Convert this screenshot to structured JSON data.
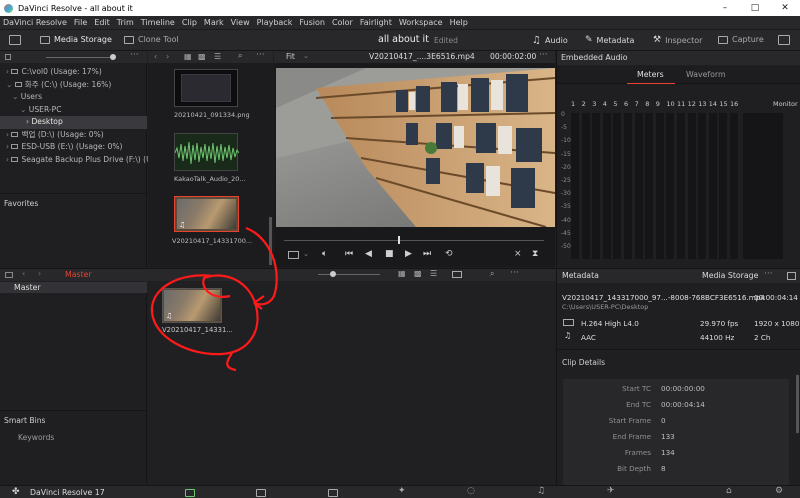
{
  "window": {
    "title": "DaVinci Resolve - all about it",
    "minimize": "–",
    "maximize": "□",
    "close": "✕"
  },
  "menu": [
    "DaVinci Resolve",
    "File",
    "Edit",
    "Trim",
    "Timeline",
    "Clip",
    "Mark",
    "View",
    "Playback",
    "Fusion",
    "Color",
    "Fairlight",
    "Workspace",
    "Help"
  ],
  "toolbar": {
    "media_storage": "Media Storage",
    "clone_tool": "Clone Tool",
    "project_name": "all about it",
    "project_status": "Edited",
    "audio": "Audio",
    "metadata": "Metadata",
    "inspector": "Inspector",
    "capture": "Capture"
  },
  "storage_tree": [
    {
      "label": "C:\\vol0 (Usage: 17%)",
      "indent": 0,
      "arrow": "›"
    },
    {
      "label": "화주 (C:\\) (Usage: 16%)",
      "indent": 0,
      "arrow": "⌄"
    },
    {
      "label": "Users",
      "indent": 1,
      "arrow": "⌄"
    },
    {
      "label": "USER-PC",
      "indent": 2,
      "arrow": "⌄"
    },
    {
      "label": "Desktop",
      "indent": 3,
      "arrow": "›"
    },
    {
      "label": "백업 (D:\\) (Usage: 0%)",
      "indent": 0,
      "arrow": "›"
    },
    {
      "label": "ESD-USB (E:\\) (Usage: 0%)",
      "indent": 0,
      "arrow": "›"
    },
    {
      "label": "Seagate Backup Plus Drive (F:\\) (Usage...",
      "indent": 0,
      "arrow": "›"
    }
  ],
  "favorites": "Favorites",
  "media_files": [
    {
      "label": "20210421_091334.png"
    },
    {
      "label": "KakaoTalk_Audio_20..."
    },
    {
      "label": "V20210417_14331700..."
    }
  ],
  "viewer": {
    "fit": "Fit",
    "clip_name": "V20210417_....3E6516.mp4",
    "timecode": "00:00:02:00"
  },
  "embedded_audio": {
    "title": "Embedded Audio",
    "tabs": [
      "Meters",
      "Waveform"
    ],
    "channels": [
      "1",
      "2",
      "3",
      "4",
      "5",
      "6",
      "7",
      "8",
      "9",
      "10",
      "11",
      "12",
      "13",
      "14",
      "15",
      "16"
    ],
    "monitor": "Monitor",
    "scale": [
      "0",
      "-5",
      "-10",
      "-15",
      "-20",
      "-25",
      "-30",
      "-35",
      "-40",
      "-45",
      "-50"
    ]
  },
  "media_pool": {
    "bin": "Master",
    "master": "Master",
    "clip_label": "V20210417_14331...",
    "smart_bins": "Smart Bins",
    "keywords": "Keywords"
  },
  "metadata_panel": {
    "title": "Metadata",
    "storage": "Media Storage",
    "filename": "V20210417_143317000_97...-8008-768BCF3E6516.mp4",
    "duration": "00:00:04:14",
    "path": "C:\\Users\\USER-PC\\Desktop",
    "codec": "H.264 High L4.0",
    "fps": "29.970 fps",
    "resolution": "1920 x 1080",
    "audio_codec": "AAC",
    "sample_rate": "44100 Hz",
    "channels": "2 Ch",
    "clip_details": "Clip Details",
    "fields": [
      {
        "label": "Start TC",
        "value": "00:00:00:00"
      },
      {
        "label": "End TC",
        "value": "00:00:04:14"
      },
      {
        "label": "Start Frame",
        "value": "0"
      },
      {
        "label": "End Frame",
        "value": "133"
      },
      {
        "label": "Frames",
        "value": "134"
      },
      {
        "label": "Bit Depth",
        "value": "8"
      }
    ]
  },
  "bottom": {
    "app_name": "DaVinci Resolve 17"
  },
  "colors": {
    "accent_red": "#e8432f",
    "annotation_red": "#ff1a1a",
    "panel_bg": "#1f1f22"
  },
  "playhead_fraction": 0.44
}
